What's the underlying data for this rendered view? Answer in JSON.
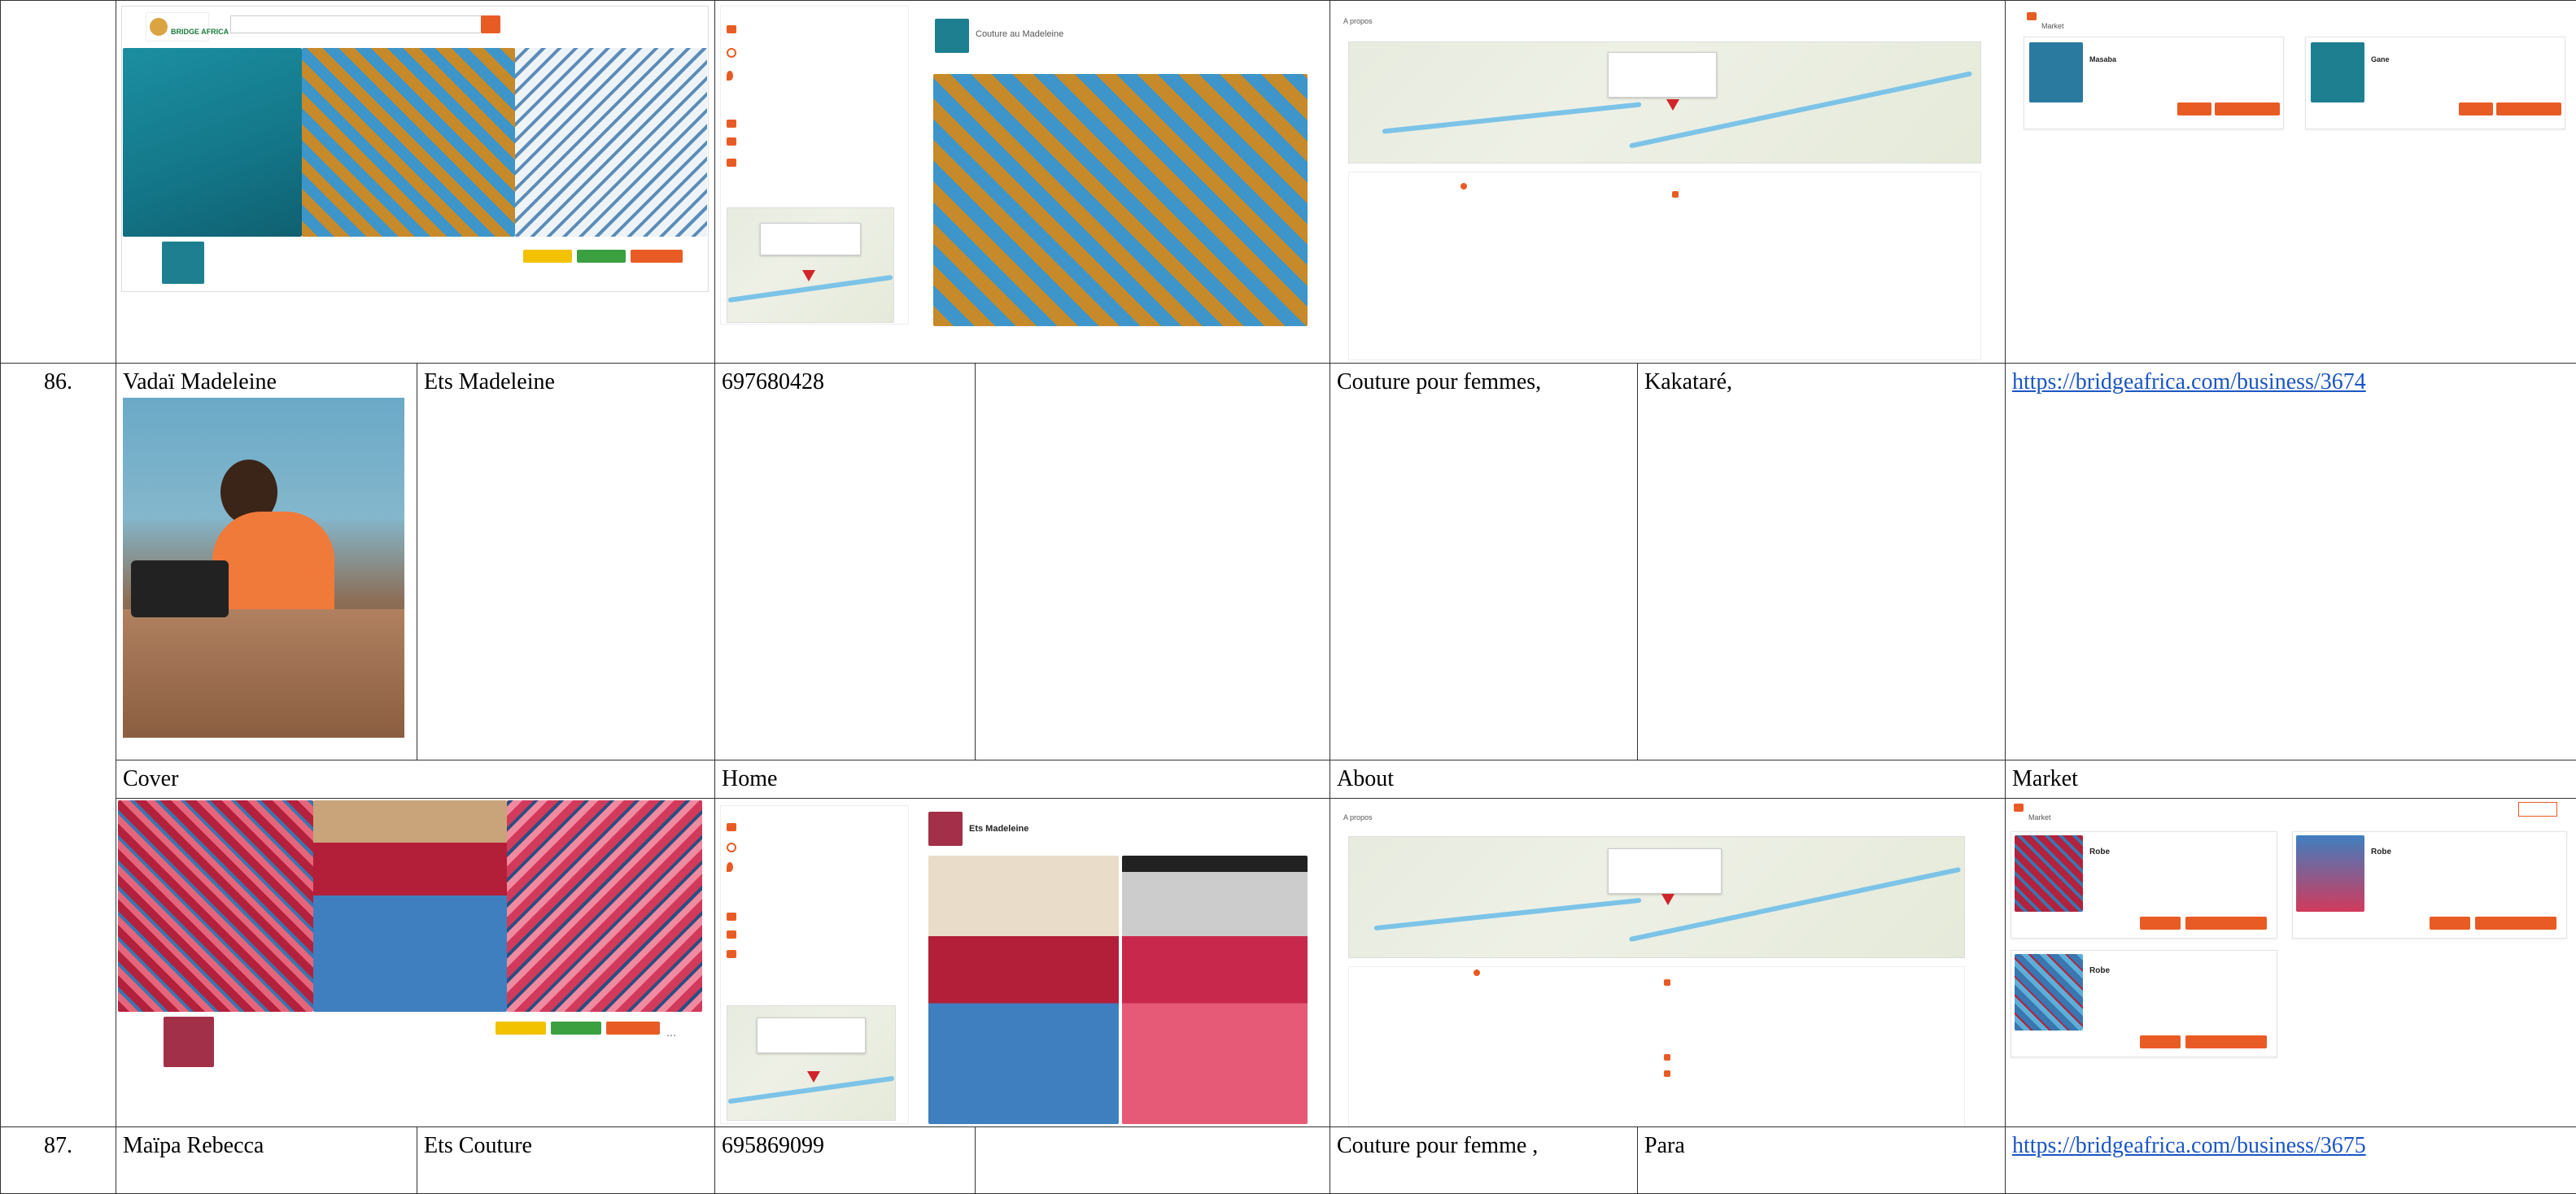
{
  "rows": [
    {
      "number": "86.",
      "owner": "Vadaï Madeleine",
      "business": "Ets Madeleine",
      "phone": "697680428",
      "activity": "Couture pour femmes,",
      "location": "Kakataré,",
      "url": "https://bridgeafrica.com/business/3674",
      "labels": {
        "cover": "Cover",
        "home": "Home",
        "about": "About",
        "market": "Market"
      },
      "home_name": "Ets Madeleine",
      "about_section": "A propos",
      "market_section": "Market",
      "products": [
        {
          "name": "Robe"
        },
        {
          "name": "Robe"
        },
        {
          "name": "Robe"
        }
      ]
    },
    {
      "number": "87.",
      "owner": "Maïpa Rebecca",
      "business": "Ets Couture",
      "phone": "695869099",
      "activity": "Couture pour femme ,",
      "location": "Para",
      "url": "https://bridgeafrica.com/business/3675"
    }
  ],
  "prev": {
    "logo_text": "BRIDGE AFRICA",
    "home_name": "Couture au Madeleine",
    "about_section": "A propos",
    "market_section": "Market",
    "products": [
      {
        "name": "Masaba"
      },
      {
        "name": "Gane"
      }
    ]
  },
  "colors": {
    "brand_orange": "#e95b24",
    "link_blue": "#1a56c4",
    "yellow_btn": "#f2c200",
    "green_btn": "#3aa040"
  }
}
